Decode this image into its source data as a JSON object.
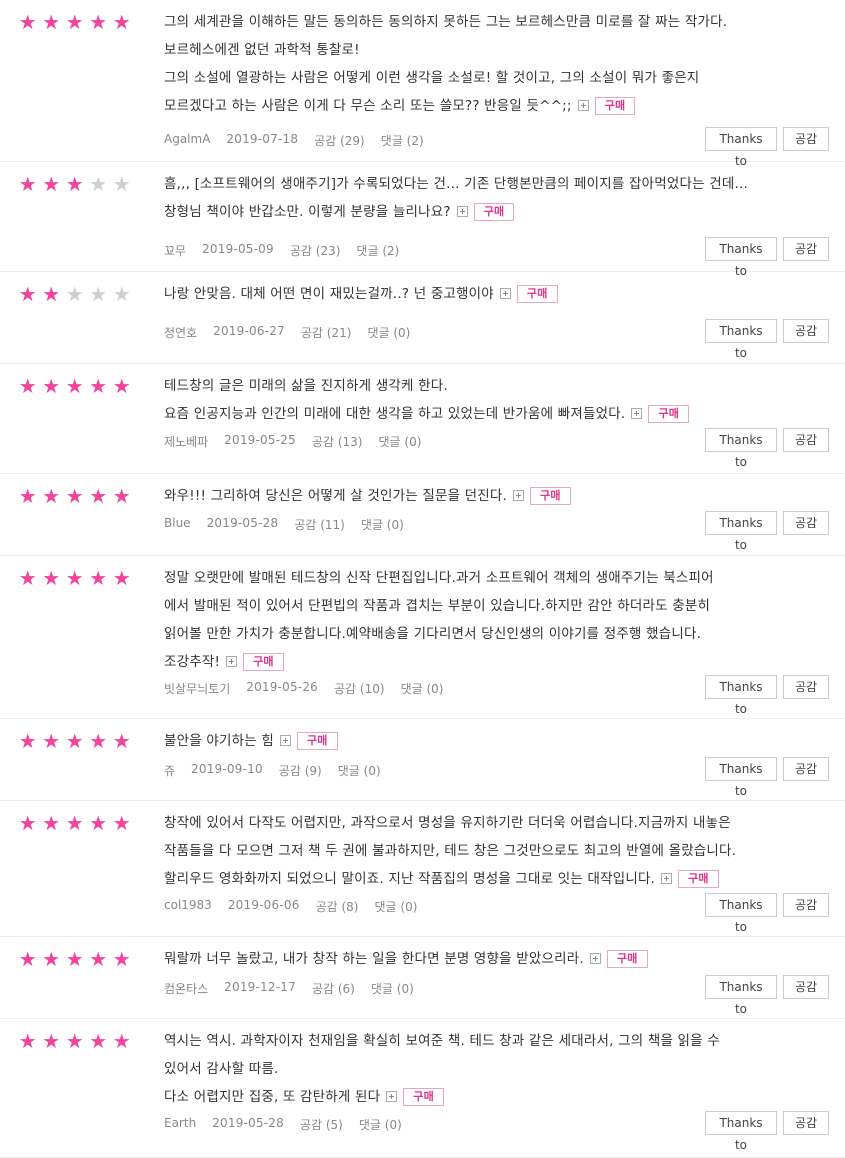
{
  "labels": {
    "like": "공감",
    "comment": "댓글",
    "thanks_button": "Thanks to",
    "like_button": "공감",
    "buy_badge": "구매"
  },
  "reviews": [
    {
      "rating": 5,
      "lines": [
        "그의 세계관을 이해하든 말든 동의하든 동의하지 못하든 그는 보르헤스만큼 미로를 잘 짜는 작가다.",
        "보르헤스에겐 없던 과학적 통찰로!",
        "그의 소설에 열광하는 사람은 어떻게 이런 생각을 소설로! 할 것이고, 그의 소설이 뭐가 좋은지",
        "모르겠다고 하는 사람은 이게 다 무슨 소리 또는 쓸모?? 반응일 듯^^;;"
      ],
      "author": "AgalmA",
      "date": "2019-07-18",
      "likes": "(29)",
      "comments": "(2)"
    },
    {
      "rating": 3,
      "lines": [
        "흠,,, [소프트웨어의 생애주기]가 수록되었다는 건... 기존 단행본만큼의 페이지를 잡아먹었다는 건데...",
        "창형님 책이야 반갑소만. 이렇게 분량을 늘리나요?"
      ],
      "author": "꾜무",
      "date": "2019-05-09",
      "likes": "(23)",
      "comments": "(2)"
    },
    {
      "rating": 2,
      "lines": [
        "나랑 안맞음. 대체 어떤 면이 재밌는걸까..? 넌 중고행이야"
      ],
      "author": "정연호",
      "date": "2019-06-27",
      "likes": "(21)",
      "comments": "(0)"
    },
    {
      "rating": 5,
      "lines": [
        "테드창의 글은 미래의 삶을 진지하게 생각케 한다.",
        "요즘 인공지능과 인간의 미래에 대한 생각을 하고 있었는데 반가움에 빠져들었다."
      ],
      "author": "제노베파",
      "date": "2019-05-25",
      "likes": "(13)",
      "comments": "(0)"
    },
    {
      "rating": 5,
      "lines": [
        "와우!!! 그리하여 당신은 어떻게 살 것인가는 질문을 던진다."
      ],
      "author": "Blue",
      "date": "2019-05-28",
      "likes": "(11)",
      "comments": "(0)"
    },
    {
      "rating": 5,
      "lines": [
        "정말 오랫만에 발매된 테드창의 신작 단편집입니다.과거 소프트웨어 객체의 생애주기는 북스피어",
        "에서 발매된 적이 있어서 단편빕의 작품과 겹치는 부분이 있습니다.하지만 감안 하더라도 충분히",
        "읽어볼 만한 가치가 충분합니다.예약배송을 기다리면서 당신인생의 이야기를 정주행 했습니다.",
        "조강추작!"
      ],
      "author": "빗살무늬토기",
      "date": "2019-05-26",
      "likes": "(10)",
      "comments": "(0)"
    },
    {
      "rating": 5,
      "lines": [
        "불안을 야기하는 힘"
      ],
      "author": "쥬",
      "date": "2019-09-10",
      "likes": "(9)",
      "comments": "(0)"
    },
    {
      "rating": 5,
      "lines": [
        "창작에 있어서 다작도 어렵지만, 과작으로서 명성을 유지하기란 더더욱 어렵습니다.지금까지 내놓은",
        "작품들을 다 모으면 그저 책 두 권에 불과하지만, 테드 창은 그것만으로도 최고의 반열에 올랐습니다.",
        "할리우드 영화화까지 되었으니 말이죠. 지난 작품집의 명성을 그대로 잇는 대작입니다."
      ],
      "author": "col1983",
      "date": "2019-06-06",
      "likes": "(8)",
      "comments": "(0)"
    },
    {
      "rating": 5,
      "lines": [
        "뭐랄까 너무 놀랐고, 내가 창작 하는 일을 한다면 분명 영향을 받았으리라."
      ],
      "author": "컴온타스",
      "date": "2019-12-17",
      "likes": "(6)",
      "comments": "(0)"
    },
    {
      "rating": 5,
      "lines": [
        "역시는 역시. 과학자이자 천재임을 확실히 보여준 책. 테드 창과 같은 세대라서, 그의 책을 읽을 수",
        "있어서 감사할 따름.",
        "다소 어렵지만 집중, 또 감탄하게 된다"
      ],
      "author": "Earth",
      "date": "2019-05-28",
      "likes": "(5)",
      "comments": "(0)"
    }
  ]
}
